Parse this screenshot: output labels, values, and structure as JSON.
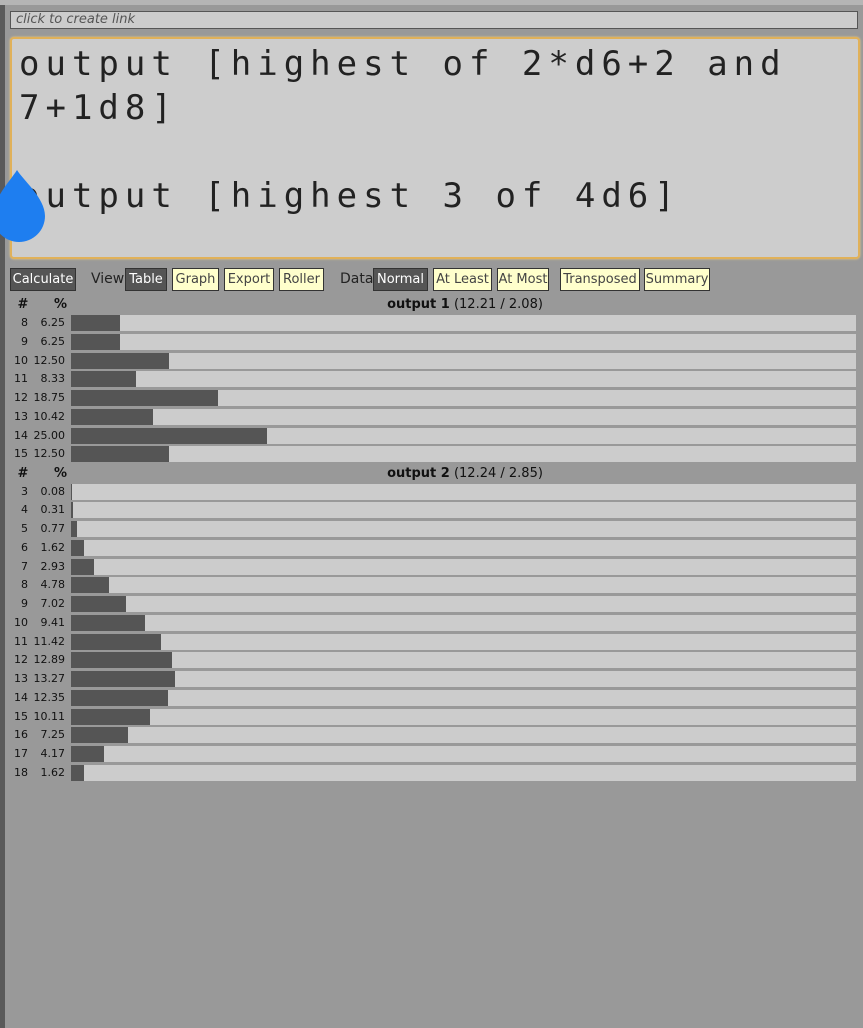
{
  "link_bar": {
    "placeholder": "click to create link"
  },
  "editor": {
    "text": "output [highest of 2*d6+2 and\n7+1d8]\n\noutput [highest 3 of 4d6]"
  },
  "toolbar": {
    "calculate": "Calculate",
    "view_label": "View",
    "view_tabs": [
      "Table",
      "Graph",
      "Export",
      "Roller"
    ],
    "view_selected": "Table",
    "data_label": "Data",
    "data_tabs": [
      "Normal",
      "At Least",
      "At Most",
      "Transposed",
      "Summary"
    ],
    "data_selected": "Normal"
  },
  "table_headers": {
    "number": "#",
    "percent": "%"
  },
  "outputs": [
    {
      "name": "output 1",
      "stats": "(12.21 / 2.08)",
      "rows": [
        {
          "n": "8",
          "p": "6.25"
        },
        {
          "n": "9",
          "p": "6.25"
        },
        {
          "n": "10",
          "p": "12.50"
        },
        {
          "n": "11",
          "p": "8.33"
        },
        {
          "n": "12",
          "p": "18.75"
        },
        {
          "n": "13",
          "p": "10.42"
        },
        {
          "n": "14",
          "p": "25.00"
        },
        {
          "n": "15",
          "p": "12.50"
        }
      ]
    },
    {
      "name": "output 2",
      "stats": "(12.24 / 2.85)",
      "rows": [
        {
          "n": "3",
          "p": "0.08"
        },
        {
          "n": "4",
          "p": "0.31"
        },
        {
          "n": "5",
          "p": "0.77"
        },
        {
          "n": "6",
          "p": "1.62"
        },
        {
          "n": "7",
          "p": "2.93"
        },
        {
          "n": "8",
          "p": "4.78"
        },
        {
          "n": "9",
          "p": "7.02"
        },
        {
          "n": "10",
          "p": "9.41"
        },
        {
          "n": "11",
          "p": "11.42"
        },
        {
          "n": "12",
          "p": "12.89"
        },
        {
          "n": "13",
          "p": "13.27"
        },
        {
          "n": "14",
          "p": "12.35"
        },
        {
          "n": "15",
          "p": "10.11"
        },
        {
          "n": "16",
          "p": "7.25"
        },
        {
          "n": "17",
          "p": "4.17"
        },
        {
          "n": "18",
          "p": "1.62"
        }
      ]
    }
  ],
  "colors": {
    "bar": "#555555",
    "track": "#cccccc",
    "button": "#ffffcc",
    "active": "#555555",
    "editor_border": "#e0b15a",
    "handle": "#1e7ef0"
  }
}
